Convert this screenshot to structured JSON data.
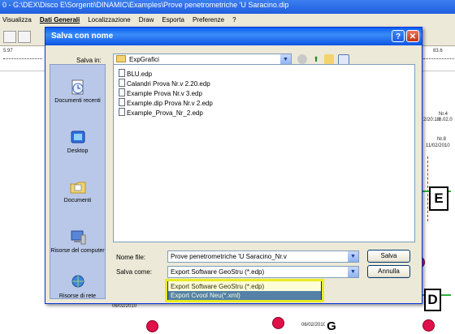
{
  "app": {
    "title": "0 - G:\\DEX\\Disco E\\Sorgenti\\DINAMIC\\Examples\\Prove penetrometriche 'U Saracino.dip",
    "menu": [
      "Visualizza",
      "Dati Generali",
      "Localizzazione",
      "Draw",
      "Esporta",
      "Preferenze",
      "?"
    ],
    "active_menu_index": 1,
    "ruler": {
      "left_value": "5.97",
      "right_value": "83.6"
    },
    "canvas_marks": [
      "Nr.4",
      "2/20:18",
      "8.02.0",
      "Nr.8",
      "11/02/2010",
      "06/02/2010",
      "06/02/2010"
    ],
    "section_labels": [
      "E",
      "D",
      "G"
    ]
  },
  "dialog": {
    "title": "Salva con nome",
    "help_label": "?",
    "close_label": "✕",
    "save_in_label": "Salva in:",
    "save_in_value": "ExpGrafici",
    "places": [
      "Documenti recenti",
      "Desktop",
      "Documenti",
      "Risorse del computer",
      "Risorse di rete"
    ],
    "files": [
      "BLU.edp",
      "Calandri Prova Nr.v 2.20.edp",
      "Example Prova Nr.v 3.edp",
      "Example.dip Prova Nr.v 2.edp",
      "Example_Prova_Nr_2.edp"
    ],
    "filename_label": "Nome file:",
    "filename_value": "Prove penetrometriche 'U Saracino_Nr.v",
    "savetype_label": "Salva come:",
    "savetype_value": "Export Software GeoStru (*.edp)",
    "save_button": "Salva",
    "cancel_button": "Annulla",
    "savetype_options": [
      "Export Software GeoStru (*.edp)",
      "Export Cvool Neu(*.xml)"
    ],
    "selected_option_index": 1
  },
  "colors": {
    "titlebar": "#0a5ff1",
    "selection": "#316ac5",
    "highlight": "#e8ec1f",
    "pin": "#e0104a"
  }
}
